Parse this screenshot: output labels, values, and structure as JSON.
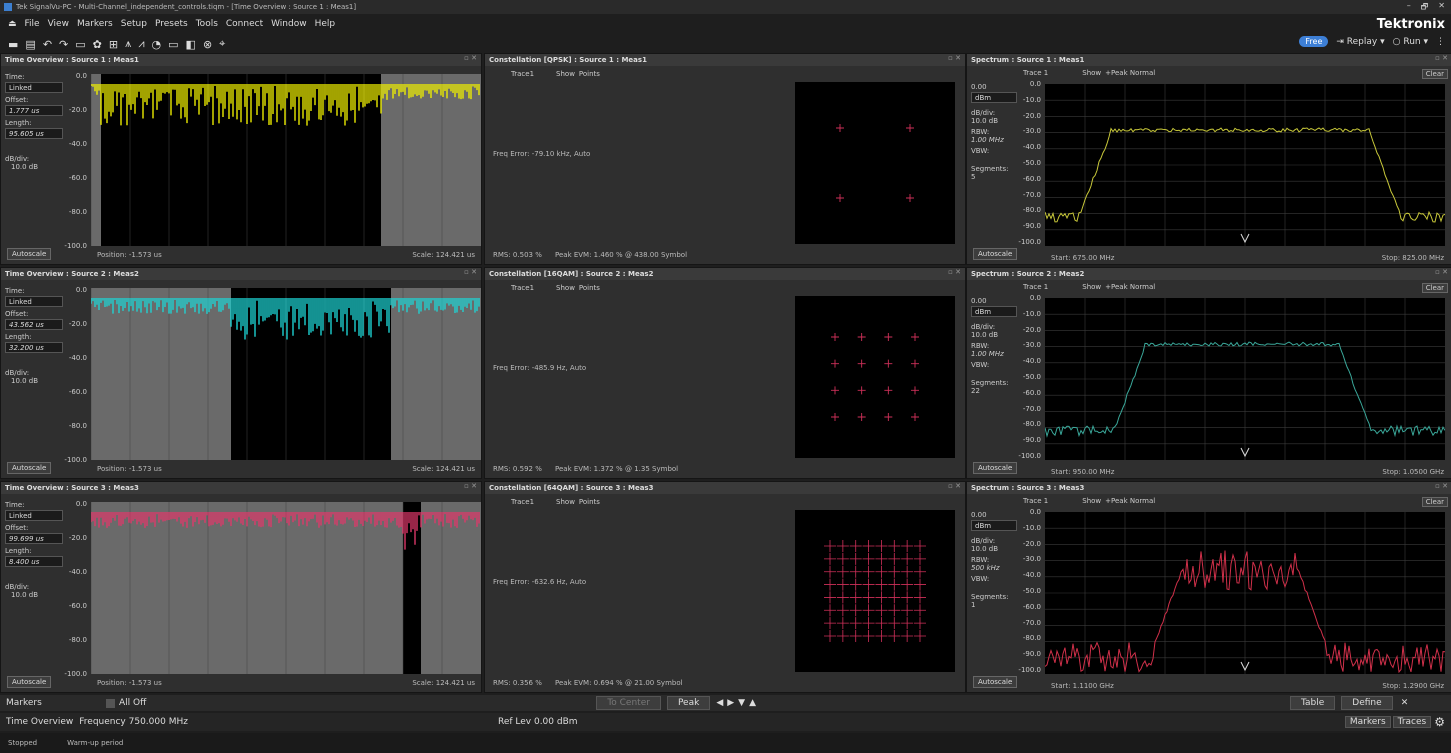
{
  "window": {
    "title": "Tek SignalVu-PC - Multi-Channel_independent_controls.tiqm - [Time Overview : Source 1 : Meas1]",
    "controls": [
      "–",
      "🗗",
      "✕"
    ]
  },
  "menu": [
    "File",
    "View",
    "Markers",
    "Setup",
    "Presets",
    "Tools",
    "Connect",
    "Window",
    "Help"
  ],
  "brand": "Tektronix",
  "toolbar": {
    "right": {
      "pill": "Free",
      "replay": "Replay",
      "run": "Run"
    }
  },
  "time_overview": [
    {
      "title": "Time Overview : Source 1 : Meas1",
      "time_label": "Time:",
      "time_mode": "Linked",
      "offset_label": "Offset:",
      "offset": "1.777 us",
      "length_label": "Length:",
      "length": "95.605 us",
      "db_div_label": "dB/div:",
      "db_div": "10.0 dB",
      "autoscale": "Autoscale",
      "position": "Position: -1.573 us",
      "scale": "Scale: 124.421 us",
      "yticks": [
        "0.0",
        "-20.0",
        "-40.0",
        "-60.0",
        "-80.0",
        "-100.0"
      ],
      "trace_color": "#f0f000"
    },
    {
      "title": "Time Overview : Source 2 : Meas2",
      "time_label": "Time:",
      "time_mode": "Linked",
      "offset_label": "Offset:",
      "offset": "43.562 us",
      "length_label": "Length:",
      "length": "32.200 us",
      "db_div_label": "dB/div:",
      "db_div": "10.0 dB",
      "autoscale": "Autoscale",
      "position": "Position: -1.573 us",
      "scale": "Scale: 124.421 us",
      "yticks": [
        "0.0",
        "-20.0",
        "-40.0",
        "-60.0",
        "-80.0",
        "-100.0"
      ],
      "trace_color": "#1fd6d6"
    },
    {
      "title": "Time Overview : Source 3 : Meas3",
      "time_label": "Time:",
      "time_mode": "Linked",
      "offset_label": "Offset:",
      "offset": "99.699 us",
      "length_label": "Length:",
      "length": "8.400 us",
      "db_div_label": "dB/div:",
      "db_div": "10.0 dB",
      "autoscale": "Autoscale",
      "position": "Position: -1.573 us",
      "scale": "Scale: 124.421 us",
      "yticks": [
        "0.0",
        "-20.0",
        "-40.0",
        "-60.0",
        "-80.0",
        "-100.0"
      ],
      "trace_color": "#e0386a"
    }
  ],
  "constellation": [
    {
      "title": "Constellation [QPSK] : Source 1 : Meas1",
      "trace": "Trace1",
      "show": "Show",
      "points": "Points",
      "freq_error": "Freq Error: -79.10 kHz, Auto",
      "rms": "RMS: 0.503 %",
      "peak_evm": "Peak EVM: 1.460 %",
      "at": "@ 438.00 Symbol",
      "order": 2
    },
    {
      "title": "Constellation [16QAM] : Source 2 : Meas2",
      "trace": "Trace1",
      "show": "Show",
      "points": "Points",
      "freq_error": "Freq Error: -485.9 Hz, Auto",
      "rms": "RMS: 0.592 %",
      "peak_evm": "Peak EVM: 1.372 %",
      "at": "@ 1.35 Symbol",
      "order": 4
    },
    {
      "title": "Constellation [64QAM] : Source 3 : Meas3",
      "trace": "Trace1",
      "show": "Show",
      "points": "Points",
      "freq_error": "Freq Error: -632.6 Hz, Auto",
      "rms": "RMS: 0.356 %",
      "peak_evm": "Peak EVM: 0.694 %",
      "at": "@ 21.00 Symbol",
      "order": 8
    }
  ],
  "spectrum": [
    {
      "title": "Spectrum : Source 1 : Meas1",
      "trace": "Trace 1",
      "show": "Show",
      "detector": "+Peak Normal",
      "clear": "Clear",
      "ref": "0.00",
      "unit": "dBm",
      "db_div_label": "dB/div:",
      "db_div": "10.0 dB",
      "rbw_label": "RBW:",
      "rbw": "1.00 MHz",
      "vbw_label": "VBW:",
      "segments_label": "Segments:",
      "segments": "5",
      "autoscale": "Autoscale",
      "start": "Start: 675.00 MHz",
      "stop": "Stop: 825.00 MHz",
      "yticks": [
        "0.0",
        "-10.0",
        "-20.0",
        "-30.0",
        "-40.0",
        "-50.0",
        "-60.0",
        "-70.0",
        "-80.0",
        "-90.0",
        "-100.0"
      ],
      "color": "#c8c83a",
      "shape": "wide"
    },
    {
      "title": "Spectrum : Source 2 : Meas2",
      "trace": "Trace 1",
      "show": "Show",
      "detector": "+Peak Normal",
      "clear": "Clear",
      "ref": "0.00",
      "unit": "dBm",
      "db_div_label": "dB/div:",
      "db_div": "10.0 dB",
      "rbw_label": "RBW:",
      "rbw": "1.00 MHz",
      "vbw_label": "VBW:",
      "segments_label": "Segments:",
      "segments": "22",
      "autoscale": "Autoscale",
      "start": "Start: 950.00 MHz",
      "stop": "Stop: 1.0500 GHz",
      "yticks": [
        "0.0",
        "-10.0",
        "-20.0",
        "-30.0",
        "-40.0",
        "-50.0",
        "-60.0",
        "-70.0",
        "-80.0",
        "-90.0",
        "-100.0"
      ],
      "color": "#3aa89a",
      "shape": "mid"
    },
    {
      "title": "Spectrum : Source 3 : Meas3",
      "trace": "Trace 1",
      "show": "Show",
      "detector": "+Peak Normal",
      "clear": "Clear",
      "ref": "0.00",
      "unit": "dBm",
      "db_div_label": "dB/div:",
      "db_div": "10.0 dB",
      "rbw_label": "RBW:",
      "rbw": "500 kHz",
      "vbw_label": "VBW:",
      "segments_label": "Segments:",
      "segments": "1",
      "autoscale": "Autoscale",
      "start": "Start: 1.1100 GHz",
      "stop": "Stop: 1.2900 GHz",
      "yticks": [
        "0.0",
        "-10.0",
        "-20.0",
        "-30.0",
        "-40.0",
        "-50.0",
        "-60.0",
        "-70.0",
        "-80.0",
        "-90.0",
        "-100.0"
      ],
      "color": "#d0304a",
      "shape": "noisy"
    }
  ],
  "bottom": {
    "markers": "Markers",
    "all_off": "All Off",
    "to_center": "To Center",
    "peak": "Peak",
    "table": "Table",
    "define": "Define",
    "close": "✕"
  },
  "status": {
    "view": "Time Overview",
    "freq": "Frequency 750.000 MHz",
    "ref_lev": "Ref Lev 0.00 dBm",
    "markers_btn": "Markers",
    "traces_btn": "Traces"
  },
  "status2": {
    "state": "Stopped",
    "warmup": "Warm-up period"
  }
}
